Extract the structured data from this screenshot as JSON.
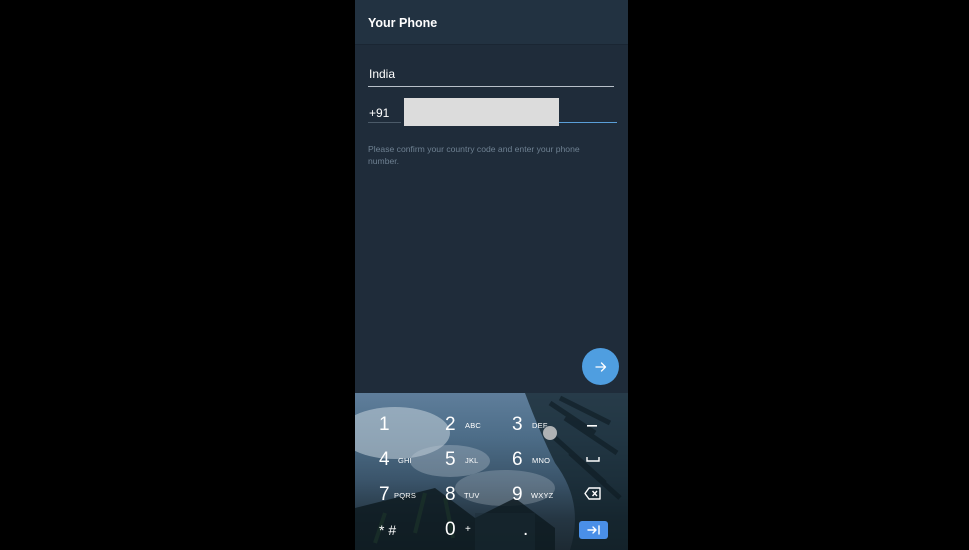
{
  "appbar": {
    "title": "Your Phone"
  },
  "form": {
    "country": "India",
    "country_code": "+91",
    "hint": "Please confirm your country code and enter your phone number."
  },
  "fab": {
    "icon": "arrow-right-icon"
  },
  "keyboard": {
    "keys": [
      {
        "num": "1",
        "sub": ""
      },
      {
        "num": "2",
        "sub": "ABC"
      },
      {
        "num": "3",
        "sub": "DEF"
      },
      {
        "num": "4",
        "sub": "GHI"
      },
      {
        "num": "5",
        "sub": "JKL"
      },
      {
        "num": "6",
        "sub": "MNO"
      },
      {
        "num": "7",
        "sub": "PQRS"
      },
      {
        "num": "8",
        "sub": "TUV"
      },
      {
        "num": "9",
        "sub": "WXYZ"
      },
      {
        "num": "* #",
        "sub": ""
      },
      {
        "num": "0",
        "sub": "+"
      },
      {
        "num": ".",
        "sub": ""
      }
    ],
    "side_keys": [
      "minus-icon",
      "space-icon",
      "backspace-icon",
      "next-icon"
    ],
    "accent": "#4a8fe7"
  },
  "colors": {
    "background": "#000000",
    "screen": "#1f2c3a",
    "accent": "#4f9ee0"
  }
}
